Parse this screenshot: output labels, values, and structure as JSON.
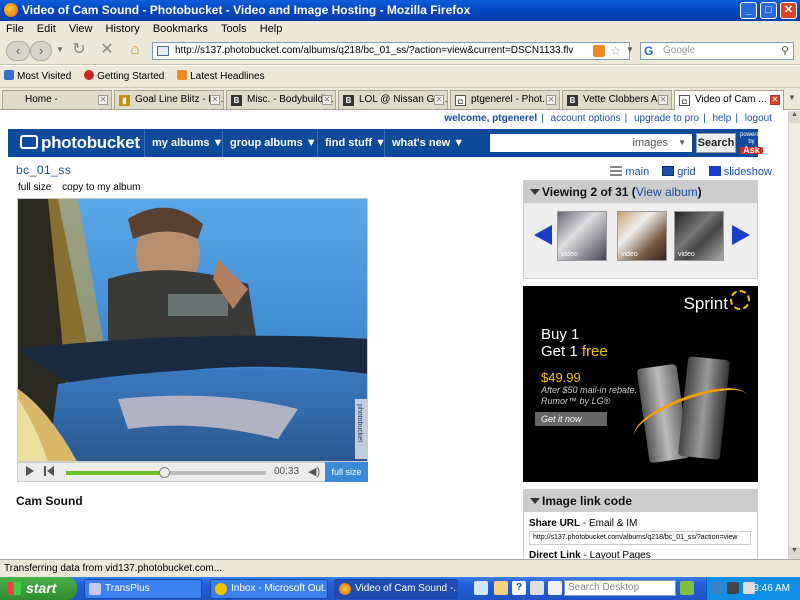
{
  "window": {
    "title": "Video of Cam Sound - Photobucket - Video and Image Hosting - Mozilla Firefox"
  },
  "menu": [
    "File",
    "Edit",
    "View",
    "History",
    "Bookmarks",
    "Tools",
    "Help"
  ],
  "nav": {
    "url": "http://s137.photobucket.com/albums/q218/bc_01_ss/?action=view&current=DSCN1133.flv",
    "search_placeholder": "Google",
    "search_engine_letter": "G"
  },
  "bookmarks": [
    "Most Visited",
    "Getting Started",
    "Latest Headlines"
  ],
  "tabs": [
    "Home -",
    "Goal Line Blitz - B...",
    "Misc. - Bodybuildi...",
    "LOL @ Nissan GT...",
    "ptgenerel - Phot...",
    "Vette Clobbers A...",
    "Video of Cam ..."
  ],
  "tab_icon_letters": [
    "",
    "",
    "B",
    "B",
    "B",
    "",
    "B",
    ""
  ],
  "toplinks": {
    "welcome": "welcome, ptgenerel",
    "account": "account options",
    "upgrade": "upgrade to pro",
    "help": "help",
    "logout": "logout"
  },
  "pbnav": {
    "logo": "photobucket",
    "menus": [
      "my albums ▼",
      "group albums ▼",
      "find stuff ▼",
      "what's new ▼"
    ],
    "search_scope": "images",
    "search_button": "Search",
    "powered_by": "powered by",
    "ask": "Ask"
  },
  "album": {
    "name": "bc_01_ss"
  },
  "view_options": [
    "main",
    "grid",
    "slideshow"
  ],
  "video_tools": {
    "full_size": "full size",
    "copy": "copy to my album"
  },
  "video": {
    "time": "00:33",
    "full_size_btn": "full size",
    "watermark": "photobucket",
    "progress": 0.49
  },
  "media": {
    "title": "Cam Sound"
  },
  "viewing": {
    "text": "Viewing 2 of 31 (",
    "link": "View album",
    "close": ")",
    "thumb_label": "video"
  },
  "ad": {
    "brand": "Sprint",
    "line1": "Buy 1",
    "line2": "Get 1 ",
    "free": "free",
    "price": "$49.99",
    "rebate": "After $50 mail-in rebate.",
    "model": "Rumor™ by LG®",
    "cta": "Get it now"
  },
  "linkcode": {
    "title": "Image link code",
    "share_label": "Share URL",
    "share_sub": " - Email & IM",
    "share_value": "http://s137.photobucket.com/albums/q218/bc_01_ss/?action=view",
    "direct_label": "Direct Link",
    "direct_sub": " - Layout Pages"
  },
  "status": "Transferring data from vid137.photobucket.com...",
  "taskbar": {
    "start": "start",
    "tasks": [
      "TransPlus",
      "Inbox - Microsoft Out...",
      "Video of Cam Sound -..."
    ],
    "desk_search": "Search Desktop",
    "clock": "9:46 AM"
  }
}
